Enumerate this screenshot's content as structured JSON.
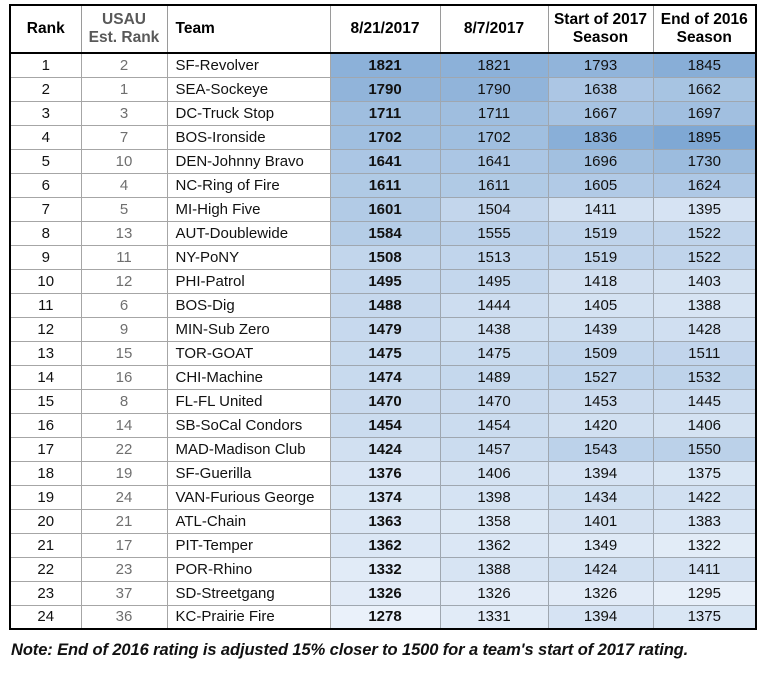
{
  "table": {
    "headers": [
      {
        "key": "rank",
        "label": "Rank"
      },
      {
        "key": "usau",
        "label": "USAU\nEst. Rank"
      },
      {
        "key": "team",
        "label": "Team"
      },
      {
        "key": "d1",
        "label": "8/21/2017"
      },
      {
        "key": "d2",
        "label": "8/7/2017"
      },
      {
        "key": "d3",
        "label": "Start of 2017\nSeason"
      },
      {
        "key": "d4",
        "label": "End of 2016\nSeason"
      }
    ],
    "rows": [
      {
        "rank": "1",
        "usau": "2",
        "team": "SF-Revolver",
        "d1": "1821",
        "d2": "1821",
        "d3": "1793",
        "d4": "1845"
      },
      {
        "rank": "2",
        "usau": "1",
        "team": "SEA-Sockeye",
        "d1": "1790",
        "d2": "1790",
        "d3": "1638",
        "d4": "1662"
      },
      {
        "rank": "3",
        "usau": "3",
        "team": "DC-Truck Stop",
        "d1": "1711",
        "d2": "1711",
        "d3": "1667",
        "d4": "1697"
      },
      {
        "rank": "4",
        "usau": "7",
        "team": "BOS-Ironside",
        "d1": "1702",
        "d2": "1702",
        "d3": "1836",
        "d4": "1895"
      },
      {
        "rank": "5",
        "usau": "10",
        "team": "DEN-Johnny Bravo",
        "d1": "1641",
        "d2": "1641",
        "d3": "1696",
        "d4": "1730"
      },
      {
        "rank": "6",
        "usau": "4",
        "team": "NC-Ring of Fire",
        "d1": "1611",
        "d2": "1611",
        "d3": "1605",
        "d4": "1624"
      },
      {
        "rank": "7",
        "usau": "5",
        "team": "MI-High Five",
        "d1": "1601",
        "d2": "1504",
        "d3": "1411",
        "d4": "1395"
      },
      {
        "rank": "8",
        "usau": "13",
        "team": "AUT-Doublewide",
        "d1": "1584",
        "d2": "1555",
        "d3": "1519",
        "d4": "1522"
      },
      {
        "rank": "9",
        "usau": "11",
        "team": "NY-PoNY",
        "d1": "1508",
        "d2": "1513",
        "d3": "1519",
        "d4": "1522"
      },
      {
        "rank": "10",
        "usau": "12",
        "team": "PHI-Patrol",
        "d1": "1495",
        "d2": "1495",
        "d3": "1418",
        "d4": "1403"
      },
      {
        "rank": "11",
        "usau": "6",
        "team": "BOS-Dig",
        "d1": "1488",
        "d2": "1444",
        "d3": "1405",
        "d4": "1388"
      },
      {
        "rank": "12",
        "usau": "9",
        "team": "MIN-Sub Zero",
        "d1": "1479",
        "d2": "1438",
        "d3": "1439",
        "d4": "1428"
      },
      {
        "rank": "13",
        "usau": "15",
        "team": "TOR-GOAT",
        "d1": "1475",
        "d2": "1475",
        "d3": "1509",
        "d4": "1511"
      },
      {
        "rank": "14",
        "usau": "16",
        "team": "CHI-Machine",
        "d1": "1474",
        "d2": "1489",
        "d3": "1527",
        "d4": "1532"
      },
      {
        "rank": "15",
        "usau": "8",
        "team": "FL-FL United",
        "d1": "1470",
        "d2": "1470",
        "d3": "1453",
        "d4": "1445"
      },
      {
        "rank": "16",
        "usau": "14",
        "team": "SB-SoCal Condors",
        "d1": "1454",
        "d2": "1454",
        "d3": "1420",
        "d4": "1406"
      },
      {
        "rank": "17",
        "usau": "22",
        "team": "MAD-Madison Club",
        "d1": "1424",
        "d2": "1457",
        "d3": "1543",
        "d4": "1550"
      },
      {
        "rank": "18",
        "usau": "19",
        "team": "SF-Guerilla",
        "d1": "1376",
        "d2": "1406",
        "d3": "1394",
        "d4": "1375"
      },
      {
        "rank": "19",
        "usau": "24",
        "team": "VAN-Furious George",
        "d1": "1374",
        "d2": "1398",
        "d3": "1434",
        "d4": "1422"
      },
      {
        "rank": "20",
        "usau": "21",
        "team": "ATL-Chain",
        "d1": "1363",
        "d2": "1358",
        "d3": "1401",
        "d4": "1383"
      },
      {
        "rank": "21",
        "usau": "17",
        "team": "PIT-Temper",
        "d1": "1362",
        "d2": "1362",
        "d3": "1349",
        "d4": "1322"
      },
      {
        "rank": "22",
        "usau": "23",
        "team": "POR-Rhino",
        "d1": "1332",
        "d2": "1388",
        "d3": "1424",
        "d4": "1411"
      },
      {
        "rank": "23",
        "usau": "37",
        "team": "SD-Streetgang",
        "d1": "1326",
        "d2": "1326",
        "d3": "1326",
        "d4": "1295"
      },
      {
        "rank": "24",
        "usau": "36",
        "team": "KC-Prairie Fire",
        "d1": "1278",
        "d2": "1331",
        "d3": "1394",
        "d4": "1375"
      }
    ],
    "value_columns": [
      "d1",
      "d2",
      "d3",
      "d4"
    ],
    "primary_column": "d1",
    "color_scale": {
      "min_value": 1278,
      "max_value": 1895,
      "min_color": "#eaf1fa",
      "max_color": "#7fa8d4"
    }
  },
  "note": {
    "text": "Note: End of 2016 rating is adjusted 15% closer to 1500 for a team's start of 2017 rating."
  }
}
